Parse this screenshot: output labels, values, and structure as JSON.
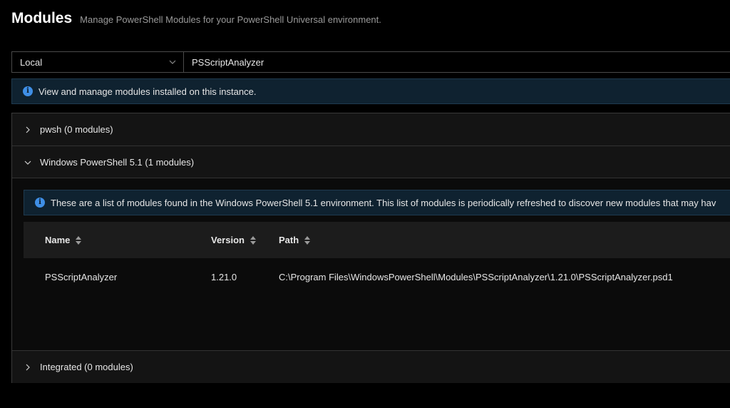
{
  "header": {
    "title": "Modules",
    "subtitle": "Manage PowerShell Modules for your PowerShell Universal environment."
  },
  "toolbar": {
    "source_select": {
      "value": "Local",
      "icon": "chevron-down-icon"
    },
    "search": {
      "value": "PSScriptAnalyzer"
    }
  },
  "info_banner": {
    "icon": "info-icon",
    "text": "View and manage modules installed on this instance."
  },
  "panels": [
    {
      "title": "pwsh (0 modules)",
      "expanded": false,
      "icon": "chevron-right-icon"
    },
    {
      "title": "Windows PowerShell 5.1 (1 modules)",
      "expanded": true,
      "icon": "chevron-down-icon"
    },
    {
      "title": "Integrated (0 modules)",
      "expanded": false,
      "icon": "chevron-right-icon"
    }
  ],
  "windows_panel": {
    "banner_text": "These are a list of modules found in the Windows PowerShell 5.1 environment. This list of modules is periodically refreshed to discover new modules that may hav",
    "table": {
      "columns": [
        "Name",
        "Version",
        "Path"
      ],
      "rows": [
        {
          "name": "PSScriptAnalyzer",
          "version": "1.21.0",
          "path": "C:\\Program Files\\WindowsPowerShell\\Modules\\PSScriptAnalyzer\\1.21.0\\PSScriptAnalyzer.psd1"
        }
      ]
    }
  },
  "colors": {
    "background": "#000000",
    "panel": "#141414",
    "banner_bg": "#0f2230",
    "info_accent": "#3f8fe6"
  }
}
